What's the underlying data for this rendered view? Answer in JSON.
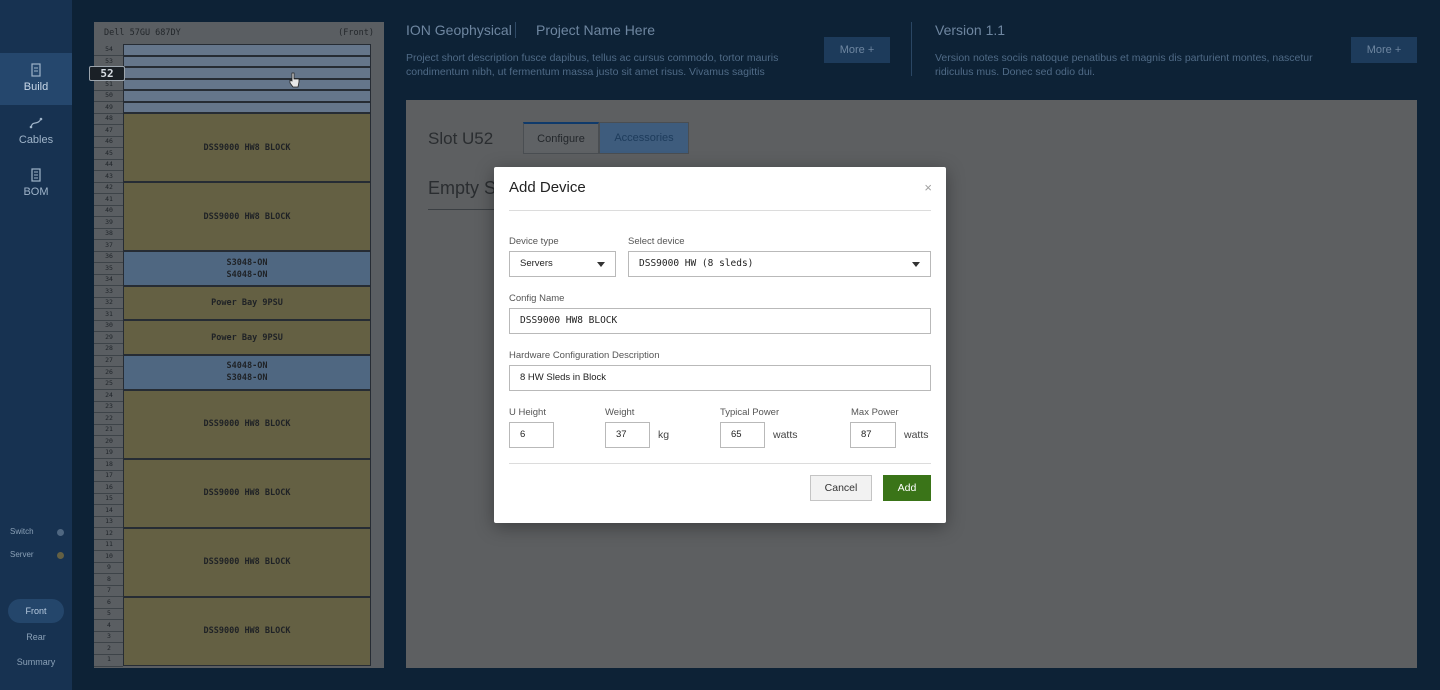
{
  "sidebar": {
    "nav": [
      {
        "label": "Build",
        "icon": "document-icon"
      },
      {
        "label": "Cables",
        "icon": "cable-icon"
      },
      {
        "label": "BOM",
        "icon": "list-icon"
      }
    ],
    "legend": [
      {
        "label": "Switch",
        "color": "#4f6781"
      },
      {
        "label": "Server",
        "color": "#646043"
      }
    ],
    "views": [
      "Front",
      "Rear",
      "Summary"
    ]
  },
  "rack": {
    "name": "Dell 57GU 687DY",
    "side": "(Front)",
    "highlight_unit": "52",
    "devices": [
      {
        "label": "DSS9000 HW8 BLOCK",
        "type": "server",
        "top_u": 48,
        "size": 6
      },
      {
        "label": "DSS9000 HW8 BLOCK",
        "type": "server",
        "top_u": 42,
        "size": 6
      },
      {
        "label": "S3048-ON\nS4048-ON",
        "type": "switch",
        "top_u": 36,
        "size": 3
      },
      {
        "label": "Power Bay 9PSU",
        "type": "power",
        "top_u": 33,
        "size": 3
      },
      {
        "label": "Power Bay 9PSU",
        "type": "power",
        "top_u": 30,
        "size": 3
      },
      {
        "label": "S4048-ON\nS3048-ON",
        "type": "switch",
        "top_u": 27,
        "size": 3
      },
      {
        "label": "DSS9000 HW8 BLOCK",
        "type": "server",
        "top_u": 24,
        "size": 6
      },
      {
        "label": "DSS9000 HW8 BLOCK",
        "type": "server",
        "top_u": 18,
        "size": 6
      },
      {
        "label": "DSS9000 HW8 BLOCK",
        "type": "server",
        "top_u": 12,
        "size": 6
      },
      {
        "label": "DSS9000 HW8 BLOCK",
        "type": "server",
        "top_u": 6,
        "size": 6
      }
    ]
  },
  "header": {
    "company": "ION Geophysical",
    "project_name": "Project Name Here",
    "project_description": "Project short description fusce dapibus, tellus ac cursus commodo, tortor mauris condimentum nibh, ut fermentum massa justo sit amet risus. Vivamus sagittis",
    "more_label": "More  +",
    "version": "Version 1.1",
    "version_notes": "Version notes sociis natoque penatibus et magnis dis parturient montes, nascetur ridiculus mus. Donec sed odio dui."
  },
  "panel": {
    "slot_title": "Slot U52",
    "tabs": [
      "Configure",
      "Accessories"
    ],
    "empty_heading": "Empty S"
  },
  "modal": {
    "title": "Add Device",
    "close_glyph": "×",
    "device_type_label": "Device type",
    "device_type_value": "Servers",
    "select_device_label": "Select device",
    "select_device_value": "DSS9000 HW (8 sleds)",
    "config_name_label": "Config Name",
    "config_name_value": "DSS9000 HW8 BLOCK",
    "hw_desc_label": "Hardware Configuration Description",
    "hw_desc_value": "8 HW Sleds in Block",
    "u_height_label": "U Height",
    "u_height_value": "6",
    "weight_label": "Weight",
    "weight_value": "37",
    "weight_unit": "kg",
    "typical_power_label": "Typical Power",
    "typical_power_value": "65",
    "typical_power_unit": "watts",
    "max_power_label": "Max Power",
    "max_power_value": "87",
    "max_power_unit": "watts",
    "cancel_label": "Cancel",
    "add_label": "Add"
  }
}
